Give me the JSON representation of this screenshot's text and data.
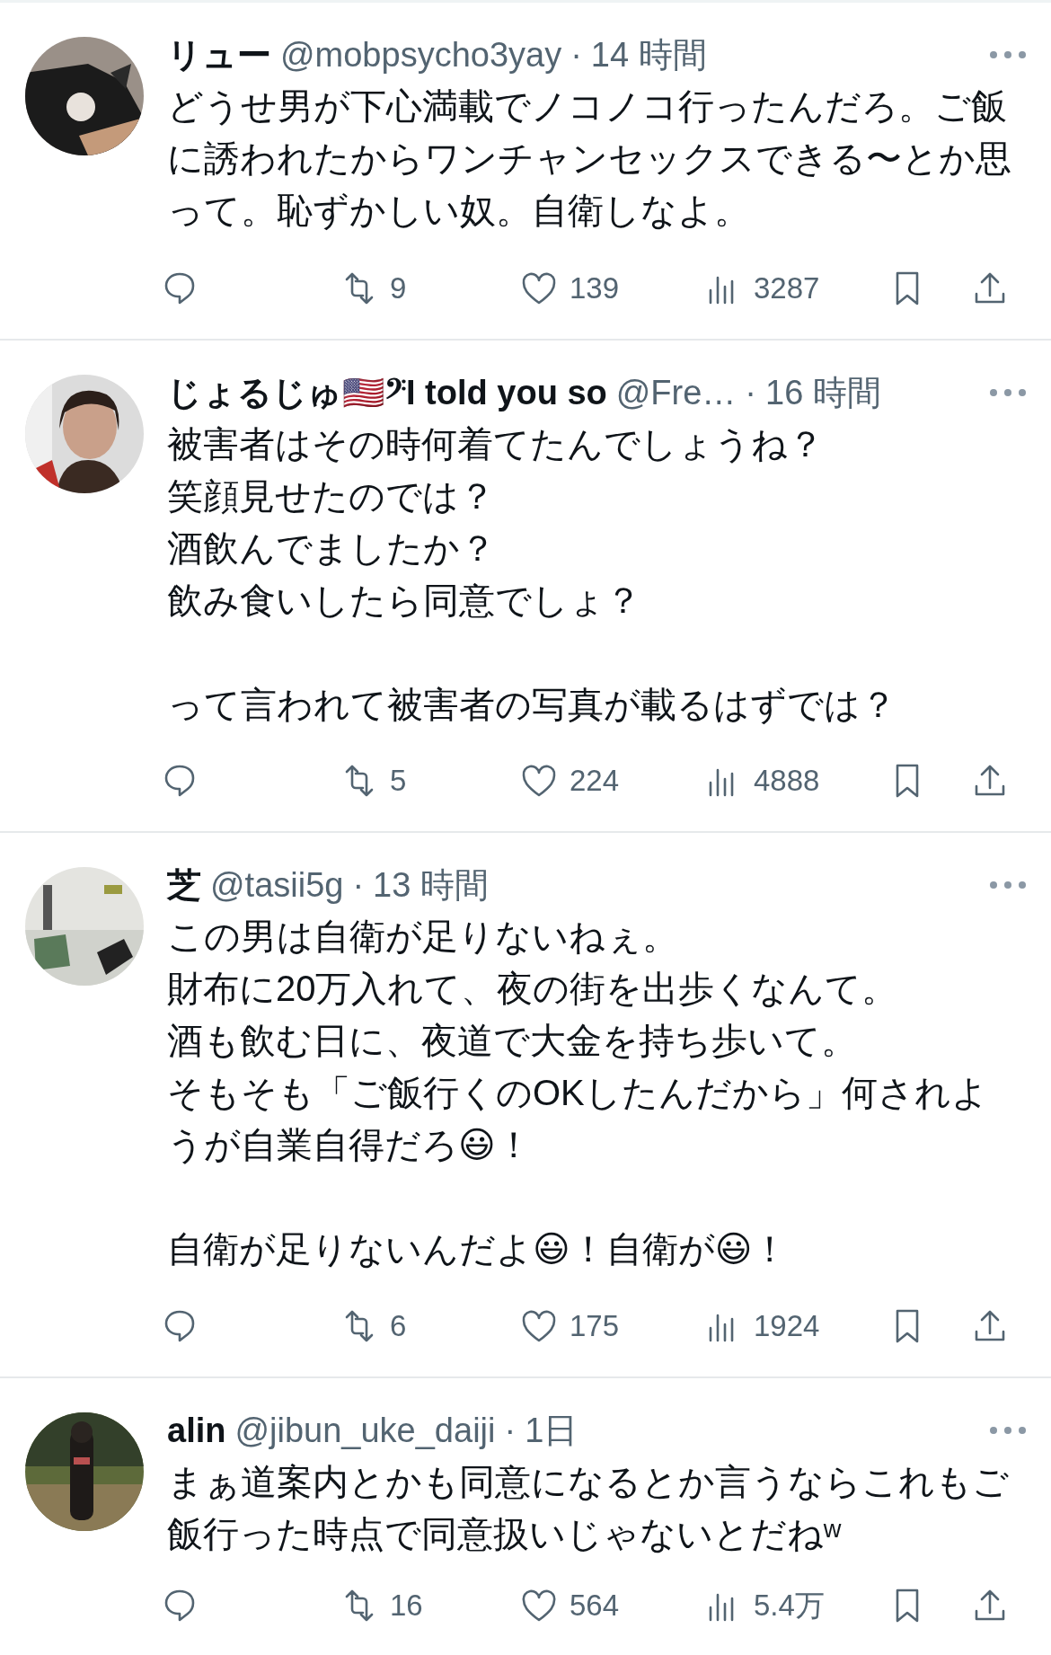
{
  "posts": [
    {
      "name": "リュー",
      "handle": "@mobpsycho3yay",
      "dot": "·",
      "time": "14 時間",
      "paragraphs": [
        [
          "どうせ男が下心満載でノコノコ行ったんだろ。ご飯に誘われたからワンチャンセックスできる〜とか思って。恥ずかしい奴。自衛しなよ。"
        ]
      ],
      "retweets": "9",
      "likes": "139",
      "views": "3287"
    },
    {
      "name": "じょるじゅ🇺🇸𝄢I told you so",
      "handle": "@Fre…",
      "dot": "·",
      "time": "16 時間",
      "paragraphs": [
        [
          "被害者はその時何着てたんでしょうね？",
          "笑顔見せたのでは？",
          "酒飲んでましたか？",
          "飲み食いしたら同意でしょ？"
        ],
        [
          "って言われて被害者の写真が載るはずでは？"
        ]
      ],
      "retweets": "5",
      "likes": "224",
      "views": "4888"
    },
    {
      "name": "芝",
      "handle": "@tasii5g",
      "dot": "·",
      "time": "13 時間",
      "paragraphs": [
        [
          "この男は自衛が足りないねぇ。",
          "財布に20万入れて、夜の街を出歩くなんて。",
          "酒も飲む日に、夜道で大金を持ち歩いて。",
          "そもそも「ご飯行くのOKしたんだから」何されようが自業自得だろ😃！"
        ],
        [
          "自衛が足りないんだよ😃！自衛が😃！"
        ]
      ],
      "retweets": "6",
      "likes": "175",
      "views": "1924"
    },
    {
      "name": "alin",
      "handle": "@jibun_uke_daiji",
      "dot": "·",
      "time": "1日",
      "paragraphs": [
        [
          "まぁ道案内とかも同意になるとか言うならこれもご飯行った時点で同意扱いじゃないとだねʷ"
        ]
      ],
      "retweets": "16",
      "likes": "564",
      "views": "5.4万"
    }
  ]
}
